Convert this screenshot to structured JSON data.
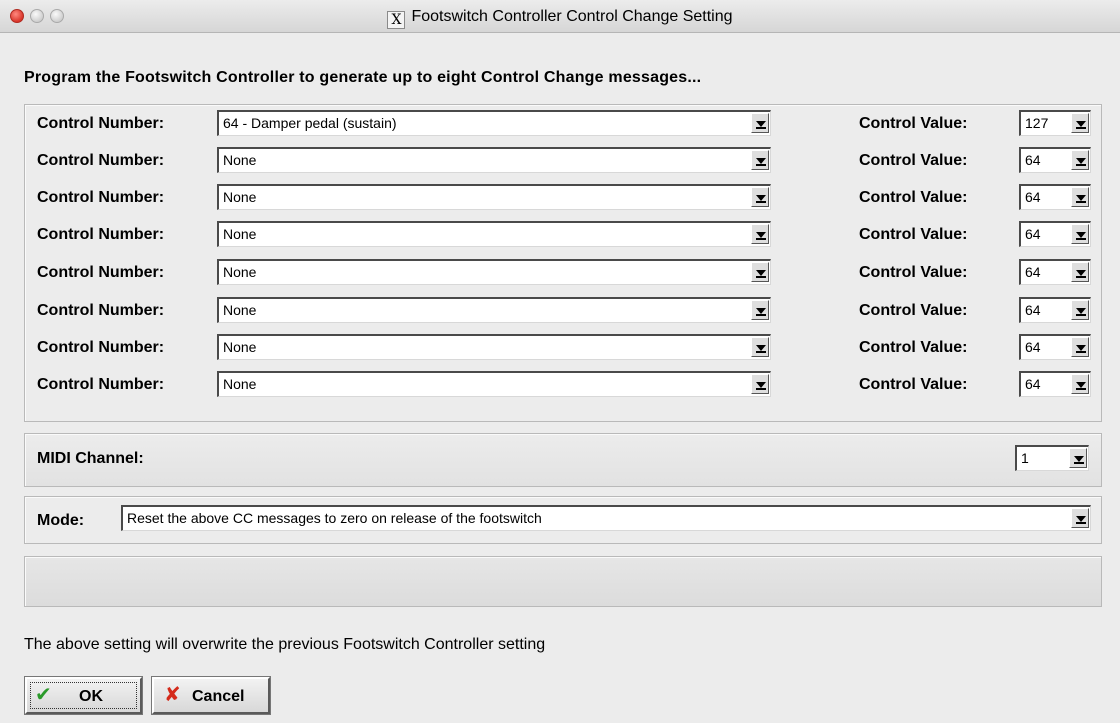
{
  "window": {
    "title": "Footswitch Controller Control Change Setting"
  },
  "intro": "Program the Footswitch Controller to generate up to eight Control Change messages...",
  "control_rows": [
    {
      "number_label": "Control Number:",
      "number_value": "64 - Damper pedal (sustain)",
      "value_label": "Control Value:",
      "value": "127"
    },
    {
      "number_label": "Control Number:",
      "number_value": "None",
      "value_label": "Control Value:",
      "value": "64"
    },
    {
      "number_label": "Control Number:",
      "number_value": "None",
      "value_label": "Control Value:",
      "value": "64"
    },
    {
      "number_label": "Control Number:",
      "number_value": "None",
      "value_label": "Control Value:",
      "value": "64"
    },
    {
      "number_label": "Control Number:",
      "number_value": "None",
      "value_label": "Control Value:",
      "value": "64"
    },
    {
      "number_label": "Control Number:",
      "number_value": "None",
      "value_label": "Control Value:",
      "value": "64"
    },
    {
      "number_label": "Control Number:",
      "number_value": "None",
      "value_label": "Control Value:",
      "value": "64"
    },
    {
      "number_label": "Control Number:",
      "number_value": "None",
      "value_label": "Control Value:",
      "value": "64"
    }
  ],
  "midi": {
    "label": "MIDI Channel:",
    "value": "1"
  },
  "mode": {
    "label": "Mode:",
    "value": "Reset the above CC messages to zero on release of the footswitch"
  },
  "note": "The above setting will overwrite the previous Footswitch Controller setting",
  "buttons": {
    "ok": "OK",
    "cancel": "Cancel"
  },
  "icons": {
    "title": "x11-icon",
    "ok": "checkmark-icon",
    "cancel": "x-mark-icon"
  },
  "colors": {
    "close_button": "#d9362b",
    "ok_icon": "#2a9a2a",
    "cancel_icon": "#d42a1a"
  }
}
